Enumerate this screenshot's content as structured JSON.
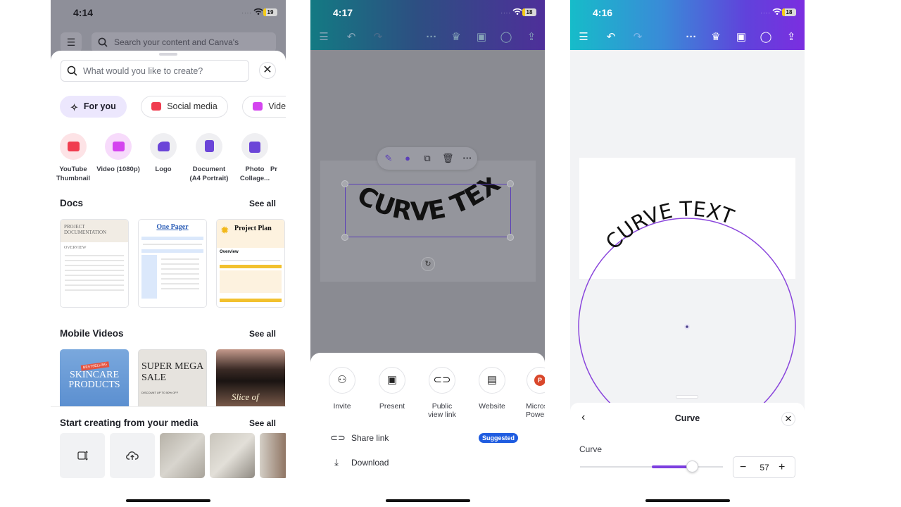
{
  "panel1": {
    "status": {
      "time": "4:14",
      "battery": "19"
    },
    "top_search_placeholder": "Search your content and Canva's",
    "create_search_placeholder": "What would you like to create?",
    "chips": [
      {
        "label": "For you",
        "active": true
      },
      {
        "label": "Social media",
        "active": false
      },
      {
        "label": "Video",
        "active": false
      }
    ],
    "categories": [
      {
        "label": "YouTube Thumbnail",
        "color": "#f03c4f",
        "bg": "#fde3e6"
      },
      {
        "label": "Video (1080p)",
        "color": "#d444ef",
        "bg": "#f7dbfb"
      },
      {
        "label": "Logo",
        "color": "#6b45d8",
        "bg": "#efeff2"
      },
      {
        "label": "Document (A4 Portrait)",
        "color": "#6b45d8",
        "bg": "#efeff2"
      },
      {
        "label": "Photo Collage...",
        "color": "#6b45d8",
        "bg": "#efeff2"
      },
      {
        "label": "Pr",
        "color": "#6b45d8",
        "bg": "#efeff2"
      }
    ],
    "docs": {
      "title": "Docs",
      "see_all": "See all",
      "items": [
        {
          "title": "PROJECT DOCUMENTATION",
          "subtitle": "OVERVIEW"
        },
        {
          "title": "One Pager"
        },
        {
          "title": "Project Plan",
          "subtitle": "Overview"
        }
      ]
    },
    "mobile_videos": {
      "title": "Mobile Videos",
      "see_all": "See all",
      "items": [
        {
          "title": "SKINCARE PRODUCTS",
          "tag": "BESTSELLING"
        },
        {
          "title": "SUPER MEGA SALE",
          "subtitle": "DISCOUNT UP TO 50% OFF"
        },
        {
          "title": "Slice of"
        }
      ]
    },
    "media": {
      "title": "Start creating from your media",
      "see_all": "See all"
    }
  },
  "panel2": {
    "status": {
      "time": "4:17",
      "battery": "18"
    },
    "canvas_text": "CURVE TEXT",
    "share_options": [
      {
        "label": "Invite",
        "icon": "invite-icon"
      },
      {
        "label": "Present",
        "icon": "present-icon"
      },
      {
        "label": "Public view link",
        "icon": "link-icon"
      },
      {
        "label": "Website",
        "icon": "website-icon"
      },
      {
        "label": "Microsoft PowerPoint",
        "icon": "powerpoint-icon"
      }
    ],
    "share_link": "Share link",
    "suggested_badge": "Suggested",
    "download": "Download"
  },
  "panel3": {
    "status": {
      "time": "4:16",
      "battery": "18"
    },
    "canvas_text": "CURVE TEXT",
    "panel_title": "Curve",
    "slider_label": "Curve",
    "curve_value": "57",
    "curve_min": -100,
    "curve_max": 100,
    "accent": "#7d3fe0"
  }
}
